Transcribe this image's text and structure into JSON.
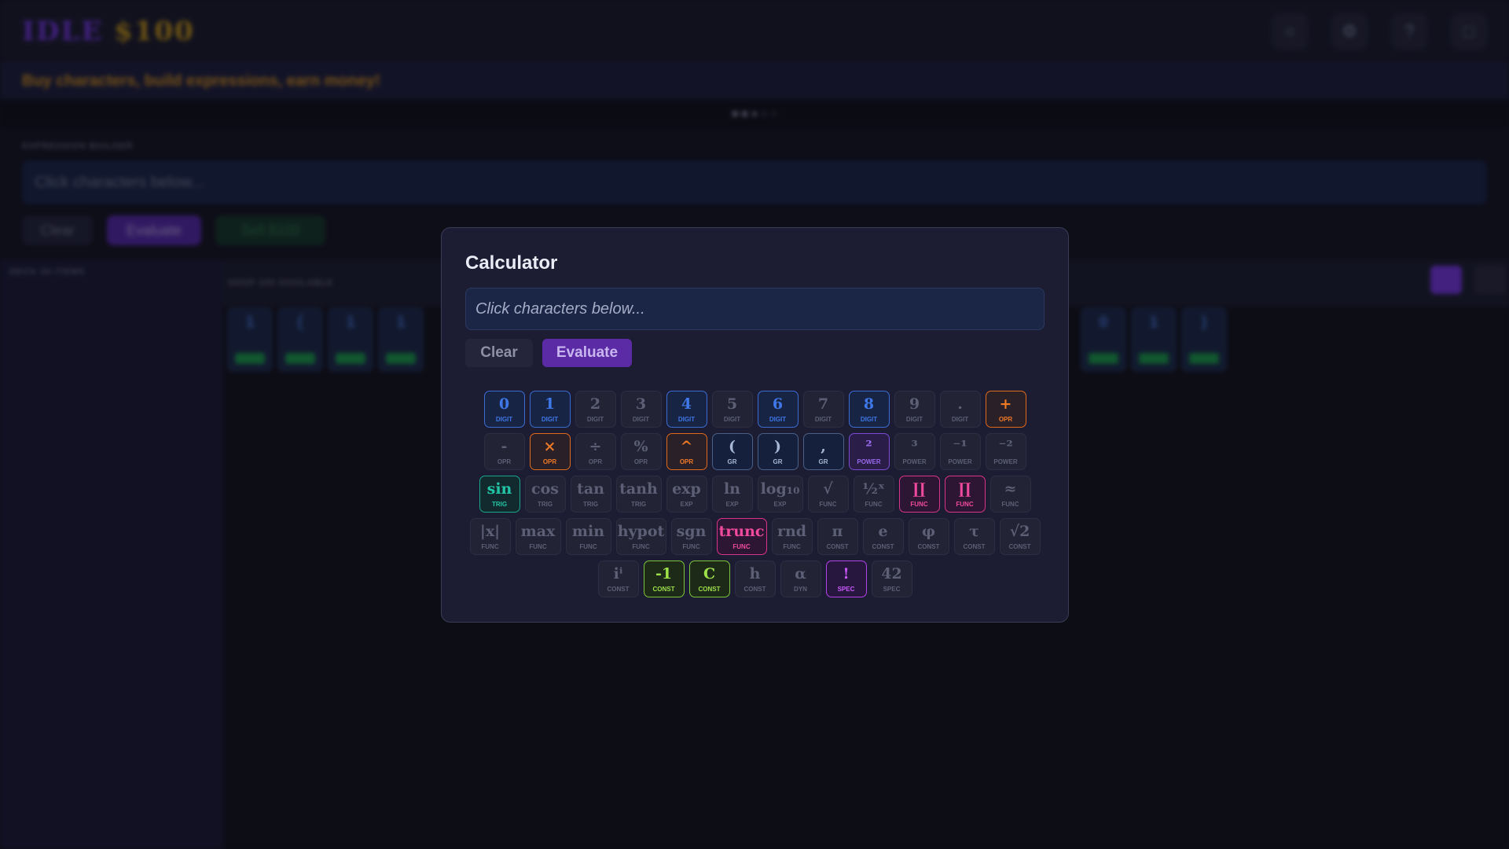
{
  "app": {
    "logo_part1": "IDLE",
    "logo_part2": "$100",
    "header_icons": [
      "lightbulb-icon",
      "gear-icon",
      "help-icon",
      "trash-icon"
    ],
    "tagline": "Buy characters, build expressions, earn money!",
    "expression_builder_label": "EXPRESSION BUILDER",
    "builder_placeholder": "Click characters below...",
    "buttons": {
      "clear": "Clear",
      "evaluate": "Evaluate",
      "sell": "Sell $100"
    },
    "deck_label": "DECK 20 ITEMS",
    "shop_label": "SHOP 100 AVAILABLE"
  },
  "calculator": {
    "title": "Calculator",
    "placeholder": "Click characters below...",
    "clear_label": "Clear",
    "evaluate_label": "Evaluate",
    "rows": [
      [
        {
          "g": "0",
          "t": "DIGIT",
          "s": "on"
        },
        {
          "g": "1",
          "t": "DIGIT",
          "s": "on"
        },
        {
          "g": "2",
          "t": "DIGIT",
          "s": "off"
        },
        {
          "g": "3",
          "t": "DIGIT",
          "s": "off"
        },
        {
          "g": "4",
          "t": "DIGIT",
          "s": "on"
        },
        {
          "g": "5",
          "t": "DIGIT",
          "s": "off"
        },
        {
          "g": "6",
          "t": "DIGIT",
          "s": "on"
        },
        {
          "g": "7",
          "t": "DIGIT",
          "s": "off"
        },
        {
          "g": "8",
          "t": "DIGIT",
          "s": "on"
        },
        {
          "g": "9",
          "t": "DIGIT",
          "s": "off"
        },
        {
          "g": ".",
          "t": "DIGIT",
          "s": "off"
        },
        {
          "g": "+",
          "t": "OPR",
          "s": "opr"
        }
      ],
      [
        {
          "g": "-",
          "t": "OPR",
          "s": "off"
        },
        {
          "g": "×",
          "t": "OPR",
          "s": "opr"
        },
        {
          "g": "÷",
          "t": "OPR",
          "s": "off"
        },
        {
          "g": "%",
          "t": "OPR",
          "s": "off"
        },
        {
          "g": "^",
          "t": "OPR",
          "s": "opr"
        },
        {
          "g": "(",
          "t": "GR",
          "s": "gr"
        },
        {
          "g": ")",
          "t": "GR",
          "s": "gr"
        },
        {
          "g": ",",
          "t": "GR",
          "s": "gr"
        },
        {
          "g": "²",
          "t": "POWER",
          "s": "pow"
        },
        {
          "g": "³",
          "t": "POWER",
          "s": "off"
        },
        {
          "g": "⁻¹",
          "t": "POWER",
          "s": "off"
        },
        {
          "g": "⁻²",
          "t": "POWER",
          "s": "off"
        }
      ],
      [
        {
          "g": "sin",
          "t": "TRIG",
          "s": "trig"
        },
        {
          "g": "cos",
          "t": "TRIG",
          "s": "off"
        },
        {
          "g": "tan",
          "t": "TRIG",
          "s": "off"
        },
        {
          "g": "tanh",
          "t": "TRIG",
          "s": "off"
        },
        {
          "g": "exp",
          "t": "EXP",
          "s": "off"
        },
        {
          "g": "ln",
          "t": "EXP",
          "s": "off"
        },
        {
          "g": "log₁₀",
          "t": "EXP",
          "s": "off"
        },
        {
          "g": "√",
          "t": "FUNC",
          "s": "off"
        },
        {
          "g": "½ˣ",
          "t": "FUNC",
          "s": "off"
        },
        {
          "g": "∐",
          "t": "FUNC",
          "s": "func"
        },
        {
          "g": "∏",
          "t": "FUNC",
          "s": "func"
        },
        {
          "g": "≈",
          "t": "FUNC",
          "s": "off"
        }
      ],
      [
        {
          "g": "|x|",
          "t": "FUNC",
          "s": "off"
        },
        {
          "g": "max",
          "t": "FUNC",
          "s": "off"
        },
        {
          "g": "min",
          "t": "FUNC",
          "s": "off"
        },
        {
          "g": "hypot",
          "t": "FUNC",
          "s": "off"
        },
        {
          "g": "sgn",
          "t": "FUNC",
          "s": "off"
        },
        {
          "g": "trunc",
          "t": "FUNC",
          "s": "func"
        },
        {
          "g": "rnd",
          "t": "FUNC",
          "s": "off"
        },
        {
          "g": "π",
          "t": "CONST",
          "s": "off"
        },
        {
          "g": "e",
          "t": "CONST",
          "s": "off"
        },
        {
          "g": "φ",
          "t": "CONST",
          "s": "off"
        },
        {
          "g": "τ",
          "t": "CONST",
          "s": "off"
        },
        {
          "g": "√2",
          "t": "CONST",
          "s": "off"
        }
      ],
      [
        {
          "g": "iⁱ",
          "t": "CONST",
          "s": "off"
        },
        {
          "g": "-1",
          "t": "CONST",
          "s": "const"
        },
        {
          "g": "C",
          "t": "CONST",
          "s": "const"
        },
        {
          "g": "h",
          "t": "CONST",
          "s": "off"
        },
        {
          "g": "α",
          "t": "DYN",
          "s": "off"
        },
        {
          "g": "!",
          "t": "SPEC",
          "s": "spec"
        },
        {
          "g": "42",
          "t": "SPEC",
          "s": "off"
        }
      ]
    ]
  }
}
